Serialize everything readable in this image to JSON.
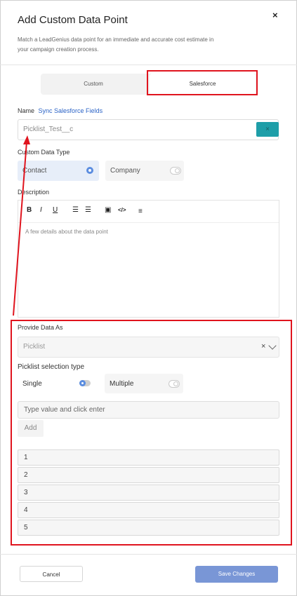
{
  "modal": {
    "title": "Add Custom Data Point",
    "subtitle": "Match a LeadGenius data point for an immediate and accurate cost estimate in your campaign creation process.",
    "close_glyph": "×"
  },
  "tabs": [
    {
      "label": "Custom",
      "selected": false
    },
    {
      "label": "Salesforce",
      "selected": true
    }
  ],
  "name_field": {
    "label": "Name",
    "link": "Sync Salesforce Fields",
    "value": "Picklist_Test__c",
    "clear_glyph": "×"
  },
  "data_type": {
    "label": "Custom Data Type",
    "options": [
      {
        "label": "Contact",
        "selected": true
      },
      {
        "label": "Company",
        "selected": false
      }
    ]
  },
  "description": {
    "label": "Description",
    "placeholder": "A few details about the data point",
    "toolbar": [
      {
        "name": "bold-icon",
        "glyph": "B"
      },
      {
        "name": "italic-icon",
        "glyph": "I"
      },
      {
        "name": "underline-icon",
        "glyph": "U"
      },
      {
        "name": "ordered-list-icon",
        "glyph": "☰"
      },
      {
        "name": "bullet-list-icon",
        "glyph": "☰"
      },
      {
        "name": "image-icon",
        "glyph": "▣"
      },
      {
        "name": "code-icon",
        "glyph": "</>"
      },
      {
        "name": "align-icon",
        "glyph": "≡"
      }
    ]
  },
  "provide_data": {
    "label": "Provide Data As",
    "selected": "Picklist",
    "clear_glyph": "×"
  },
  "picklist": {
    "label": "Picklist selection type",
    "options": [
      {
        "label": "Single",
        "selected": true
      },
      {
        "label": "Multiple",
        "selected": false
      }
    ],
    "input_placeholder": "Type value and click enter",
    "add_label": "Add",
    "values": [
      "1",
      "2",
      "3",
      "4",
      "5"
    ]
  },
  "footer": {
    "cancel_label": "Cancel",
    "save_label": "Save Changes"
  },
  "colors": {
    "accent": "#1e9ea8",
    "primary_button": "#7996d6",
    "link": "#2b63c6",
    "annotation": "#e0141e",
    "selected_option": "#e7eef9"
  }
}
